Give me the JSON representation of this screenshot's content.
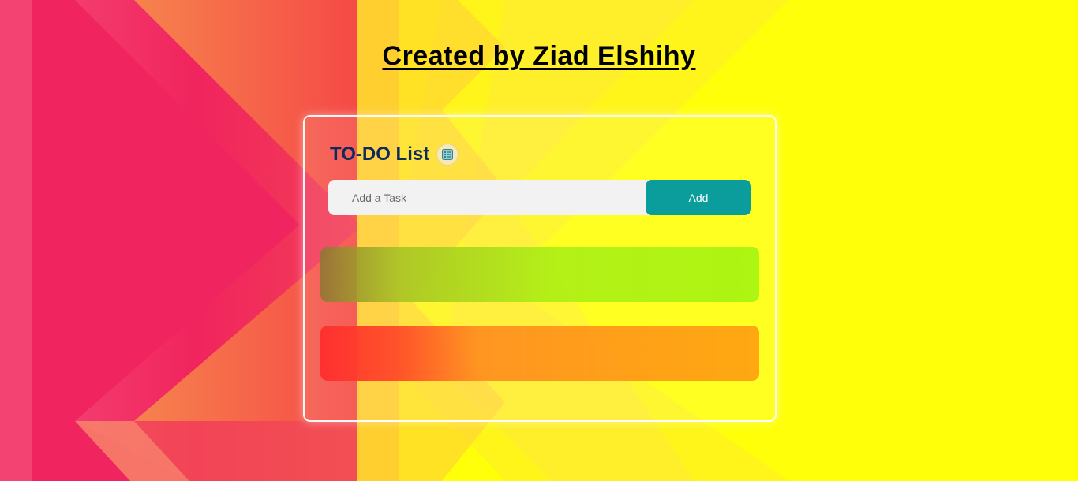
{
  "header": {
    "credit": "Created by Ziad Elshihy"
  },
  "todo": {
    "title": "TO-DO List",
    "title_icon": "checklist-icon",
    "input_placeholder": "Add a Task",
    "input_value": "",
    "add_label": "Add",
    "tasks": [
      {
        "text": "",
        "color": "#adf512"
      },
      {
        "text": "",
        "color": "#ffa812"
      }
    ]
  },
  "colors": {
    "background_yellow": "#ffff0a",
    "background_pink": "#f0225f",
    "heading": "#0d2a5c",
    "add_button": "#0b9c9c"
  }
}
